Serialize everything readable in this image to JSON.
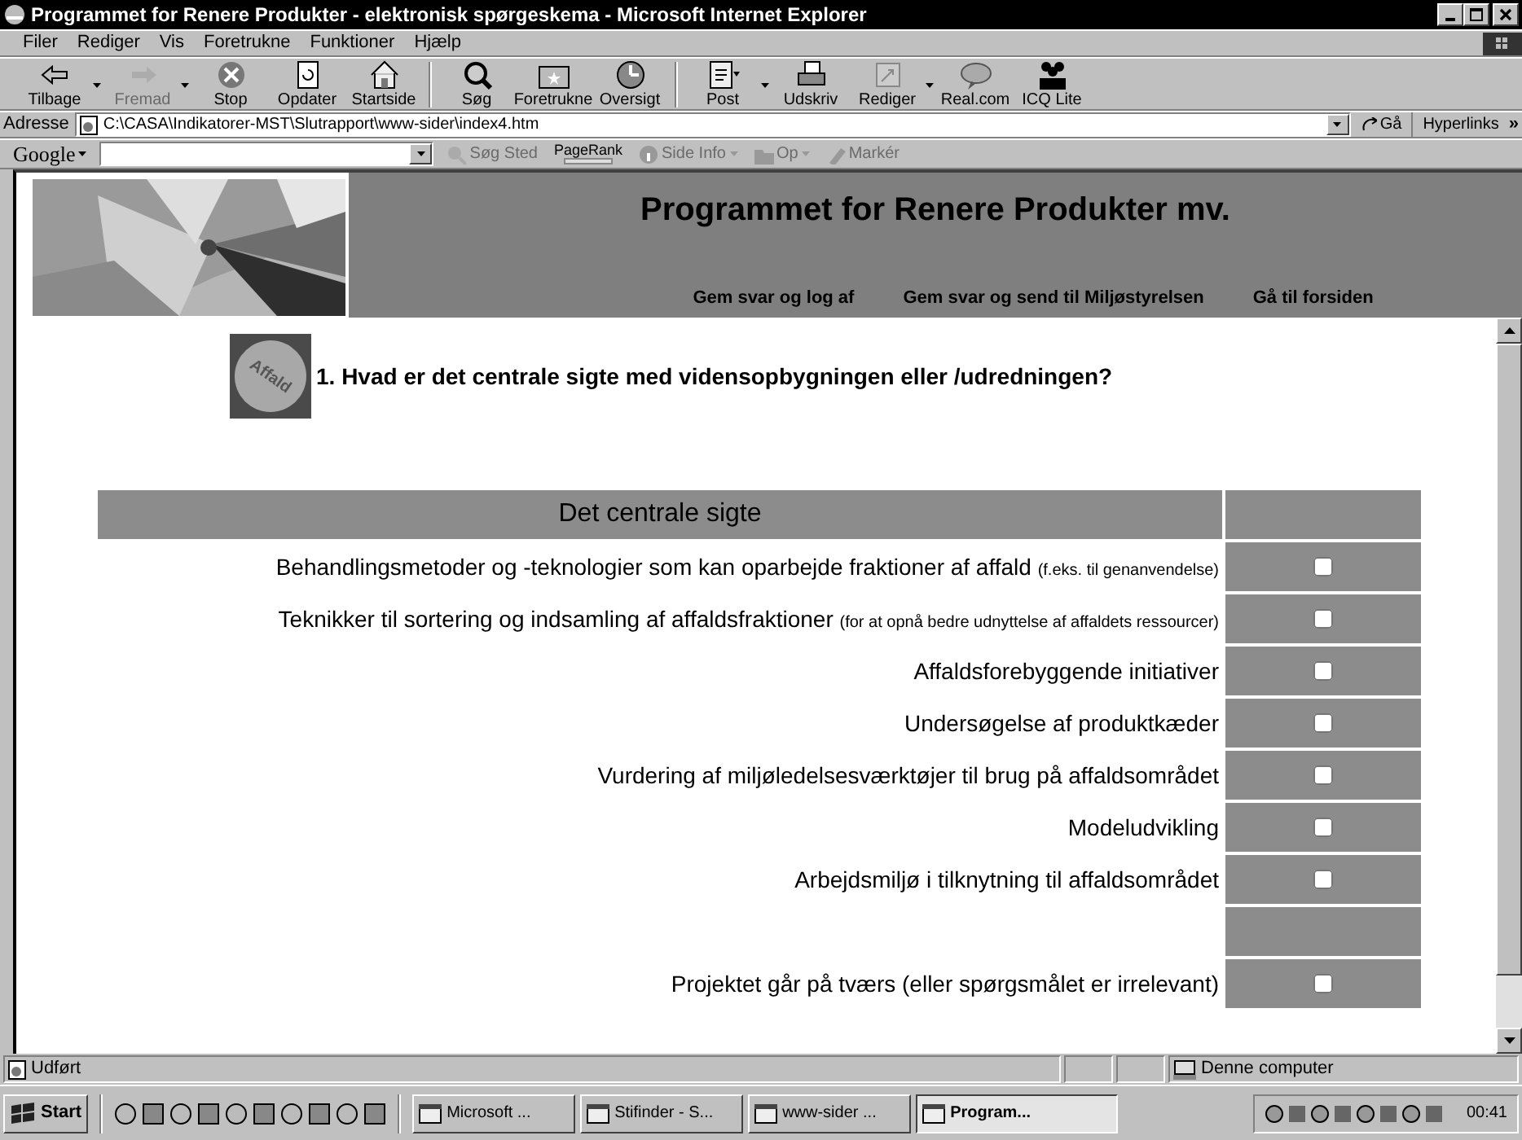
{
  "window": {
    "title": "Programmet for Renere Produkter - elektronisk spørgeskema - Microsoft Internet Explorer"
  },
  "menu": [
    "Filer",
    "Rediger",
    "Vis",
    "Foretrukne",
    "Funktioner",
    "Hjælp"
  ],
  "toolbar": [
    [
      {
        "label": "Tilbage",
        "disabled": false,
        "dropdown": true
      },
      {
        "label": "Fremad",
        "disabled": true,
        "dropdown": true
      },
      {
        "label": "Stop",
        "disabled": false,
        "dropdown": false
      },
      {
        "label": "Opdater",
        "disabled": false,
        "dropdown": false
      },
      {
        "label": "Startside",
        "disabled": false,
        "dropdown": false
      }
    ],
    [
      {
        "label": "Søg",
        "disabled": false,
        "dropdown": false
      },
      {
        "label": "Foretrukne",
        "disabled": false,
        "dropdown": false
      },
      {
        "label": "Oversigt",
        "disabled": false,
        "dropdown": false
      }
    ],
    [
      {
        "label": "Post",
        "disabled": false,
        "dropdown": true
      },
      {
        "label": "Udskriv",
        "disabled": false,
        "dropdown": false
      },
      {
        "label": "Rediger",
        "disabled": false,
        "dropdown": true
      },
      {
        "label": "Real.com",
        "disabled": false,
        "dropdown": false
      },
      {
        "label": "ICQ Lite",
        "disabled": false,
        "dropdown": false
      }
    ]
  ],
  "address": {
    "label": "Adresse",
    "value": "C:\\CASA\\Indikatorer-MST\\Slutrapport\\www-sider\\index4.htm",
    "go": "Gå",
    "links": "Hyperlinks",
    "more": "»"
  },
  "google": {
    "logo": "Google",
    "buttons": [
      {
        "label": "Søg Sted",
        "disabled": true,
        "dropdown": false
      },
      {
        "label": "PageRank",
        "disabled": false,
        "dropdown": false
      },
      {
        "label": "Side Info",
        "disabled": true,
        "dropdown": true
      },
      {
        "label": "Op",
        "disabled": true,
        "dropdown": true
      },
      {
        "label": "Markér",
        "disabled": true,
        "dropdown": false
      }
    ]
  },
  "header": {
    "title": "Programmet for Renere Produkter mv.",
    "links": [
      "Gem svar og log af",
      "Gem svar og send til Miljøstyrelsen",
      "Gå til forsiden"
    ]
  },
  "question": {
    "badge": "Affald",
    "text": "1. Hvad er det centrale sigte med vidensopbygningen eller /udredningen?"
  },
  "table": {
    "header": "Det centrale sigte",
    "rows": [
      {
        "kind": "option",
        "label": "Behandlingsmetoder og -teknologier som kan oparbejde fraktioner af affald",
        "note": "(f.eks. til genanvendelse)",
        "checked": false
      },
      {
        "kind": "option",
        "label": "Teknikker til sortering og indsamling af affaldsfraktioner",
        "note": "(for at opnå bedre udnyttelse af affaldets ressourcer)",
        "checked": false
      },
      {
        "kind": "option",
        "label": "Affaldsforebyggende initiativer",
        "checked": false
      },
      {
        "kind": "option",
        "label": "Undersøgelse af produktkæder",
        "checked": false
      },
      {
        "kind": "option",
        "label": "Vurdering af miljøledelsesværktøjer til brug på affaldsområdet",
        "checked": false
      },
      {
        "kind": "option",
        "label": "Modeludvikling",
        "checked": false
      },
      {
        "kind": "option",
        "label": "Arbejdsmiljø i tilknytning til affaldsområdet",
        "checked": false
      },
      {
        "kind": "spacer"
      },
      {
        "kind": "option",
        "label": "Projektet går på tværs (eller spørgsmålet er irrelevant)",
        "checked": false
      }
    ]
  },
  "status_bar": {
    "text": "Udført",
    "zone": "Denne computer"
  },
  "taskbar": {
    "start": "Start",
    "tasks": [
      {
        "label": "Microsoft ...",
        "selected": false
      },
      {
        "label": "Stifinder - S...",
        "selected": false
      },
      {
        "label": "www-sider ...",
        "selected": false
      },
      {
        "label": "Program...",
        "selected": true
      }
    ],
    "clock": "00:41"
  }
}
